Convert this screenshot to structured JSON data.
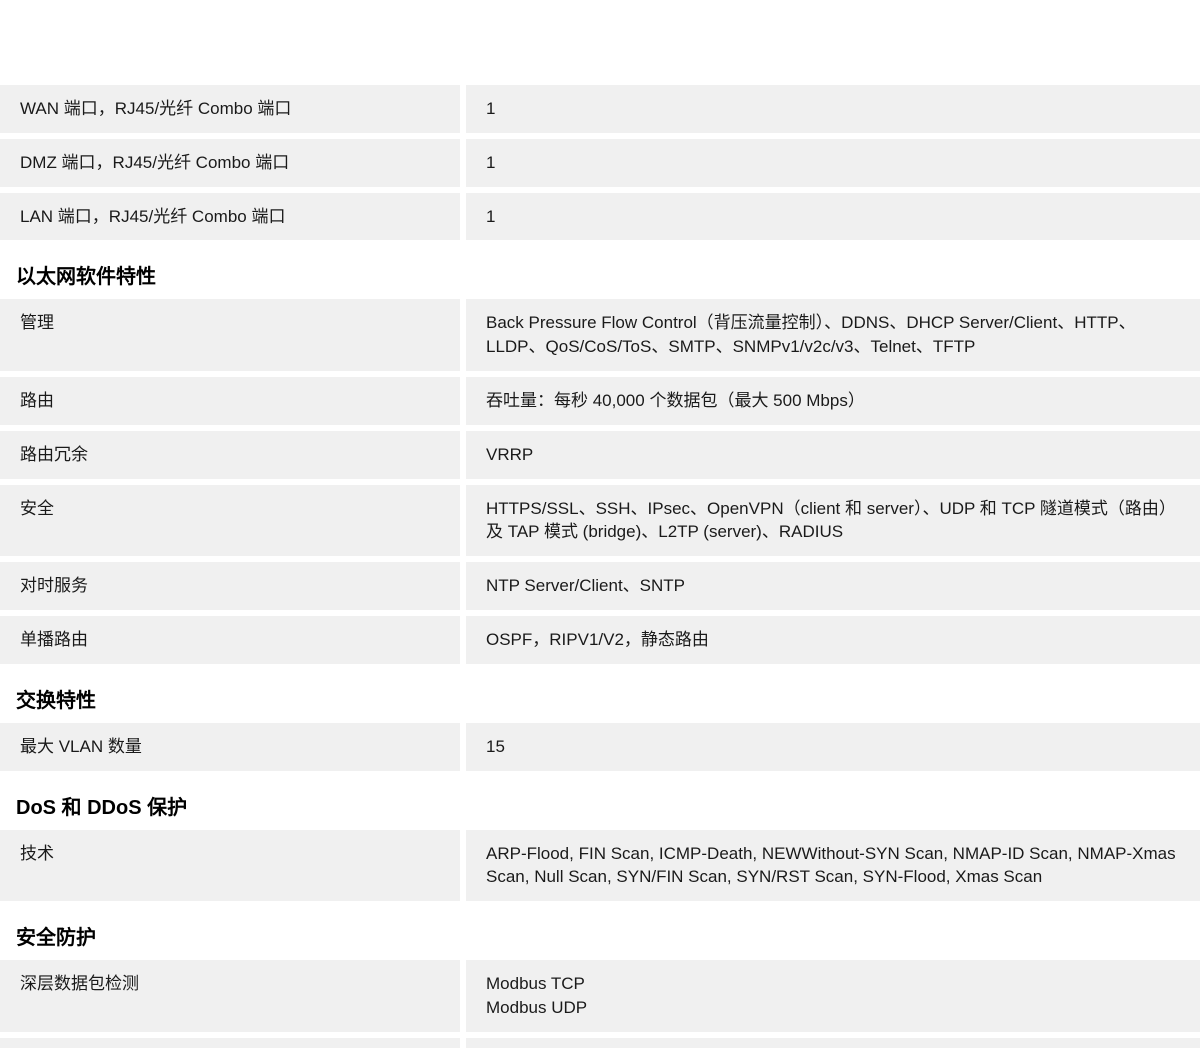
{
  "sections": [
    {
      "title": null,
      "rows": [
        {
          "label": "WAN 端口，RJ45/光纤 Combo 端口",
          "value": "1"
        },
        {
          "label": "DMZ 端口，RJ45/光纤 Combo 端口",
          "value": "1"
        },
        {
          "label": "LAN 端口，RJ45/光纤 Combo 端口",
          "value": "1"
        }
      ]
    },
    {
      "title": "以太网软件特性",
      "rows": [
        {
          "label": "管理",
          "value": "Back Pressure Flow Control（背压流量控制）、DDNS、DHCP Server/Client、HTTP、LLDP、QoS/CoS/ToS、SMTP、SNMPv1/v2c/v3、Telnet、TFTP"
        },
        {
          "label": "路由",
          "value": "吞吐量：每秒 40,000 个数据包（最大 500 Mbps）"
        },
        {
          "label": "路由冗余",
          "value": "VRRP"
        },
        {
          "label": "安全",
          "value": "HTTPS/SSL、SSH、IPsec、OpenVPN（client 和 server）、UDP 和 TCP 隧道模式（路由）及 TAP 模式 (bridge)、L2TP (server)、RADIUS"
        },
        {
          "label": "对时服务",
          "value": "NTP Server/Client、SNTP"
        },
        {
          "label": "单播路由",
          "value": "OSPF，RIPV1/V2，静态路由"
        }
      ]
    },
    {
      "title": "交换特性",
      "rows": [
        {
          "label": "最大 VLAN 数量",
          "value": "15"
        }
      ]
    },
    {
      "title": "DoS 和 DDoS 保护",
      "rows": [
        {
          "label": "技术",
          "value": "ARP-Flood, FIN Scan, ICMP-Death, NEWWithout-SYN Scan, NMAP-ID Scan, NMAP-Xmas Scan, Null Scan, SYN/FIN Scan, SYN/RST Scan, SYN-Flood, Xmas Scan"
        }
      ]
    },
    {
      "title": "安全防护",
      "rows": [
        {
          "label": "深层数据包检测",
          "value": "Modbus TCP\nModbus UDP"
        }
      ]
    }
  ]
}
